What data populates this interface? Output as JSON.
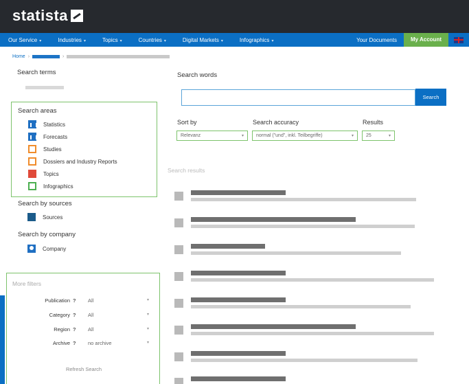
{
  "header": {
    "logo_text": "statista",
    "logo_icon": "statista-mark-icon"
  },
  "nav": {
    "items": [
      {
        "label": "Our Service",
        "caret": "▾"
      },
      {
        "label": "Industries",
        "caret": "▾"
      },
      {
        "label": "Topics",
        "caret": "▾"
      },
      {
        "label": "Countries",
        "caret": "▾"
      },
      {
        "label": "Digital Markets",
        "caret": "▾"
      },
      {
        "label": "Infographics",
        "caret": "▾"
      }
    ],
    "my_documents": "Your Documents",
    "my_account": "My Account",
    "flag_icon": "uk-flag-icon"
  },
  "breadcrumb": {
    "home": "Home",
    "separator": "›"
  },
  "left": {
    "search_terms_title": "Search terms",
    "search_areas_title": "Search areas",
    "areas": [
      {
        "label": "Statistics",
        "icon": "statistics-icon"
      },
      {
        "label": "Forecasts",
        "icon": "forecasts-icon"
      },
      {
        "label": "Studies",
        "icon": "studies-icon"
      },
      {
        "label": "Dossiers and Industry Reports",
        "icon": "dossiers-icon"
      },
      {
        "label": "Topics",
        "icon": "topics-icon"
      },
      {
        "label": "Infographics",
        "icon": "infographics-icon"
      }
    ],
    "sources_title": "Search by sources",
    "sources_label": "Sources",
    "company_title": "Search by company",
    "company_label": "Company",
    "more_filters_title": "More filters",
    "filters": [
      {
        "label": "Publication",
        "help": "?",
        "value": "All",
        "caret": "▾"
      },
      {
        "label": "Category",
        "help": "?",
        "value": "All",
        "caret": "▾"
      },
      {
        "label": "Region",
        "help": "?",
        "value": "All",
        "caret": "▾"
      },
      {
        "label": "Archive",
        "help": "?",
        "value": "no archive",
        "caret": "▾"
      }
    ],
    "refresh_label": "Refresh Search"
  },
  "main": {
    "search_words_label": "Search words",
    "search_input_value": "",
    "search_button": "Search",
    "sort_by_label": "Sort by",
    "sort_by_value": "Relevanz",
    "accuracy_label": "Search accuracy",
    "accuracy_value": "normal (\"und\", inkl. Teilbegriffe)",
    "results_label": "Results",
    "results_value": "25",
    "caret": "▾",
    "search_results_label": "Search results"
  },
  "colors": {
    "header_bg": "#26292e",
    "nav_bg": "#0b6fc4",
    "account_green": "#6ab04c",
    "border_green": "#7cc36b"
  }
}
